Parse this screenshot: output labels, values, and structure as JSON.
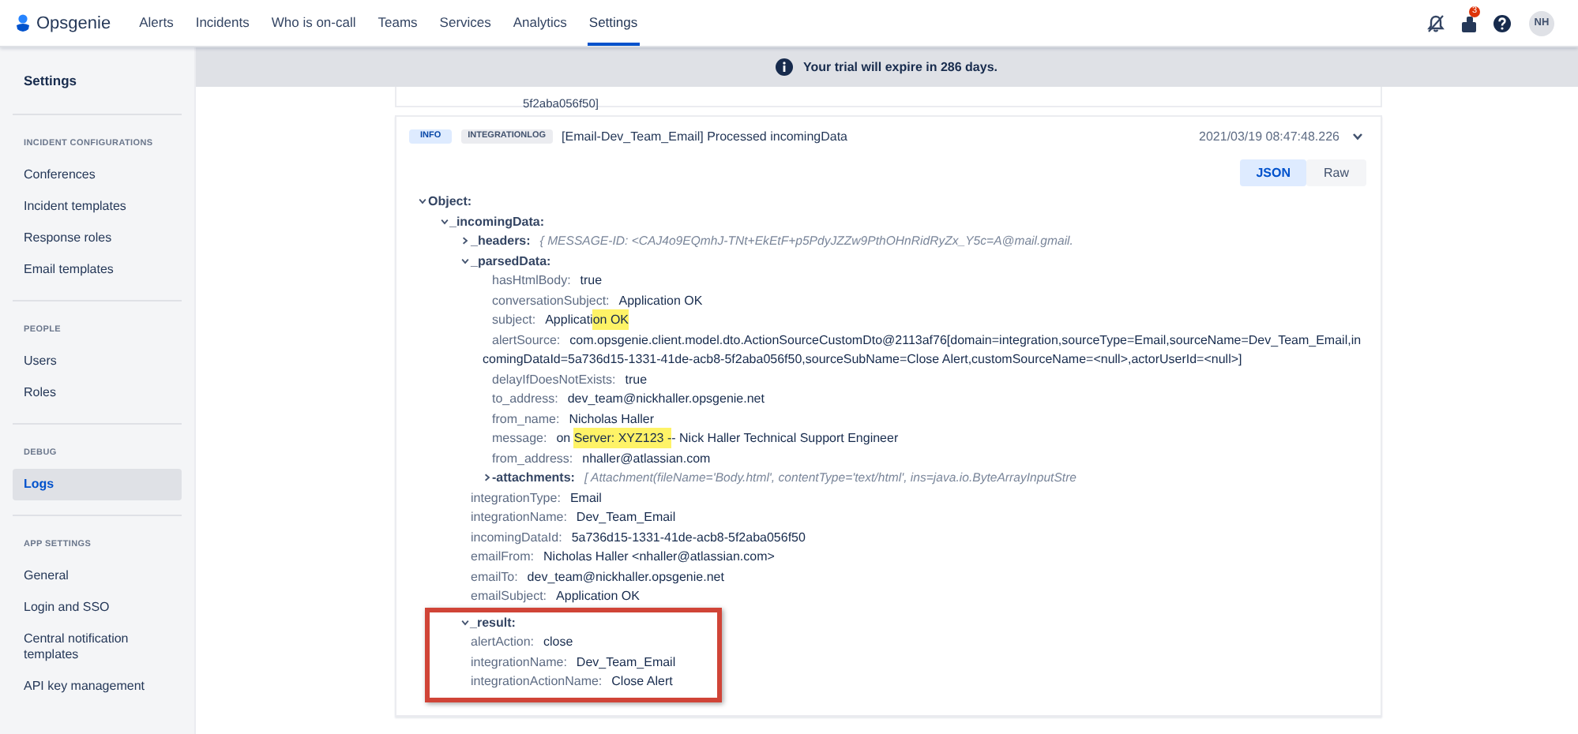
{
  "topbar": {
    "product": "Opsgenie",
    "nav": [
      {
        "label": "Alerts",
        "selected": false
      },
      {
        "label": "Incidents",
        "selected": false
      },
      {
        "label": "Who is on-call",
        "selected": false
      },
      {
        "label": "Teams",
        "selected": false
      },
      {
        "label": "Services",
        "selected": false
      },
      {
        "label": "Analytics",
        "selected": false
      },
      {
        "label": "Settings",
        "selected": true
      }
    ],
    "notification_badge": "3",
    "avatar": "NH"
  },
  "sidebar": {
    "title": "Settings",
    "sections": [
      {
        "heading": "INCIDENT CONFIGURATIONS",
        "items": [
          {
            "label": "Conferences",
            "selected": false
          },
          {
            "label": "Incident templates",
            "selected": false
          },
          {
            "label": "Response roles",
            "selected": false
          },
          {
            "label": "Email templates",
            "selected": false
          }
        ]
      },
      {
        "heading": "PEOPLE",
        "items": [
          {
            "label": "Users",
            "selected": false
          },
          {
            "label": "Roles",
            "selected": false
          }
        ]
      },
      {
        "heading": "DEBUG",
        "items": [
          {
            "label": "Logs",
            "selected": true
          }
        ]
      },
      {
        "heading": "APP SETTINGS",
        "items": [
          {
            "label": "General",
            "selected": false
          },
          {
            "label": "Login and SSO",
            "selected": false
          },
          {
            "label": "Central notification templates",
            "selected": false
          },
          {
            "label": "API key management",
            "selected": false
          }
        ]
      }
    ]
  },
  "banner": {
    "text": "Your trial will expire in 286 days."
  },
  "previous_entry": {
    "text": "5f2aba056f50]"
  },
  "log_entry": {
    "level": "INFO",
    "source": "INTEGRATIONLOG",
    "message": "[Email-Dev_Team_Email] Processed incomingData",
    "timestamp": "2021/03/19 08:47:48.226",
    "expanded": true,
    "view_modes": [
      {
        "label": "JSON",
        "selected": true
      },
      {
        "label": "Raw",
        "selected": false
      }
    ],
    "tree": [
      {
        "key": "Object:",
        "expanded": true,
        "children": [
          {
            "key": "_incomingData:",
            "expanded": true,
            "children": [
              {
                "key": "_headers:",
                "expanded": false,
                "preview": "{ MESSAGE-ID: <CAJ4o9EQmhJ-TNt+EkEtF+p5PdyJZZw9PthOHnRidRyZx_Y5c=A@mail.gmail."
              },
              {
                "key": "_parsedData:",
                "expanded": true,
                "children": [
                  {
                    "key": "hasHtmlBody:",
                    "value": "true"
                  },
                  {
                    "key": "conversationSubject:",
                    "value": "Application OK"
                  },
                  {
                    "key": "subject:",
                    "value_parts": [
                      {
                        "text": "Applicati",
                        "highlighted": false
                      },
                      {
                        "text": "on OK",
                        "highlighted": true
                      }
                    ]
                  },
                  {
                    "key": "alertSource:",
                    "value": "com.opsgenie.client.model.dto.ActionSourceCustomDto@2113af76[domain=integration,sourceType=Email,sourceName=Dev_Team_Email,incomingDataId=5a736d15-1331-41de-acb8-5f2aba056f50,sourceSubName=Close Alert,customSourceName=<null>,actorUserId=<null>]"
                  },
                  {
                    "key": "delayIfDoesNotExists:",
                    "value": "true"
                  },
                  {
                    "key": "to_address:",
                    "value": "dev_team@nickhaller.opsgenie.net"
                  },
                  {
                    "key": "from_name:",
                    "value": "Nicholas Haller"
                  },
                  {
                    "key": "message:",
                    "value_parts": [
                      {
                        "text": "on ",
                        "highlighted": false
                      },
                      {
                        "text": "Server: XYZ123 -",
                        "highlighted": true
                      },
                      {
                        "text": "- Nick Haller Technical Support Engineer",
                        "highlighted": false
                      }
                    ]
                  },
                  {
                    "key": "from_address:",
                    "value": "nhaller@atlassian.com"
                  },
                  {
                    "key": "-attachments:",
                    "expanded": false,
                    "preview": "[ Attachment(fileName='Body.html', contentType='text/html', ins=java.io.ByteArrayInputStre"
                  }
                ]
              },
              {
                "key": "integrationType:",
                "value": "Email"
              },
              {
                "key": "integrationName:",
                "value": "Dev_Team_Email"
              },
              {
                "key": "incomingDataId:",
                "value": "5a736d15-1331-41de-acb8-5f2aba056f50"
              },
              {
                "key": "emailFrom:",
                "value": "Nicholas Haller <nhaller@atlassian.com>"
              },
              {
                "key": "emailTo:",
                "value": "dev_team@nickhaller.opsgenie.net"
              },
              {
                "key": "emailSubject:",
                "value": "Application OK"
              }
            ]
          },
          {
            "key": "_result:",
            "expanded": true,
            "annotated": true,
            "children": [
              {
                "key": "alertAction:",
                "value": "close"
              },
              {
                "key": "integrationName:",
                "value": "Dev_Team_Email"
              },
              {
                "key": "integrationActionName:",
                "value": "Close Alert"
              }
            ]
          }
        ]
      }
    ]
  }
}
